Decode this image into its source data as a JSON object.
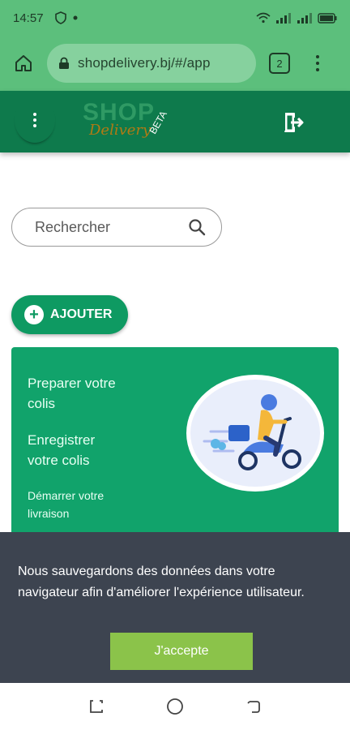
{
  "status_bar": {
    "time": "14:57"
  },
  "browser": {
    "url": "shopdelivery.bj/#/app",
    "tab_count": "2"
  },
  "header": {
    "logo_text": "SHOP",
    "logo_subtext": "Delivery",
    "badge": "BETA"
  },
  "search": {
    "placeholder": "Rechercher"
  },
  "add_button": {
    "label": "AJOUTER"
  },
  "steps": [
    {
      "label": "Preparer votre colis"
    },
    {
      "label": "Enregistrer votre colis"
    },
    {
      "label": "Démarrer votre livraison"
    }
  ],
  "cookie": {
    "message": "Nous sauvegardons des données dans votre navigateur afin d'améliorer l'expérience utilisateur.",
    "accept_label": "J'accepte"
  },
  "colors": {
    "status_bar": "#5cbf7c",
    "app_header": "#0e7a4c",
    "card": "#11a36b",
    "cookie_banner": "#3d4450",
    "accept_button": "#8bc34a"
  }
}
